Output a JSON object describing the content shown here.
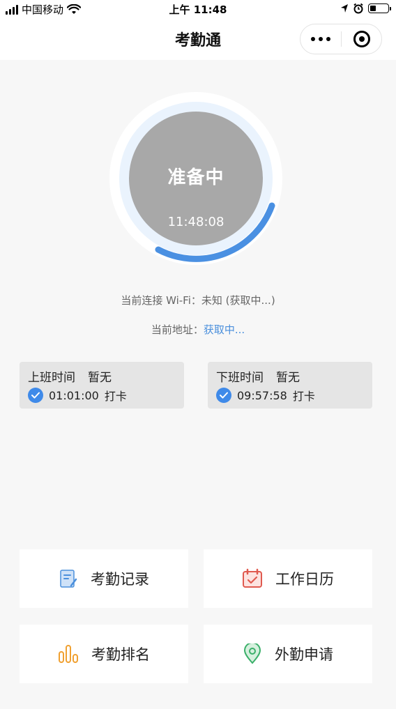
{
  "status_bar": {
    "carrier": "中国移动",
    "time": "上午 11:48",
    "battery_level": 0.3
  },
  "nav": {
    "title": "考勤通"
  },
  "clock": {
    "status": "准备中",
    "time": "11:48:08",
    "progress_arc_color": "#4a90e2",
    "inner_color": "#a8a8a8"
  },
  "info": {
    "wifi_label": "当前连接 Wi-Fi：",
    "wifi_value": "未知 (获取中...)",
    "address_label": "当前地址：",
    "address_value": "获取中..."
  },
  "cards": [
    {
      "title": "上班时间",
      "value": "暂无",
      "time": "01:01:00",
      "action": "打卡"
    },
    {
      "title": "下班时间",
      "value": "暂无",
      "time": "09:57:58",
      "action": "打卡"
    }
  ],
  "menu": [
    {
      "label": "考勤记录",
      "icon": "record-icon",
      "color": "#4a8fdc"
    },
    {
      "label": "工作日历",
      "icon": "calendar-icon",
      "color": "#e05a4f"
    },
    {
      "label": "考勤排名",
      "icon": "ranking-icon",
      "color": "#f0a030"
    },
    {
      "label": "外勤申请",
      "icon": "location-icon",
      "color": "#3bb06a"
    }
  ],
  "colors": {
    "accent": "#3f8ae9",
    "background": "#f7f7f7"
  }
}
